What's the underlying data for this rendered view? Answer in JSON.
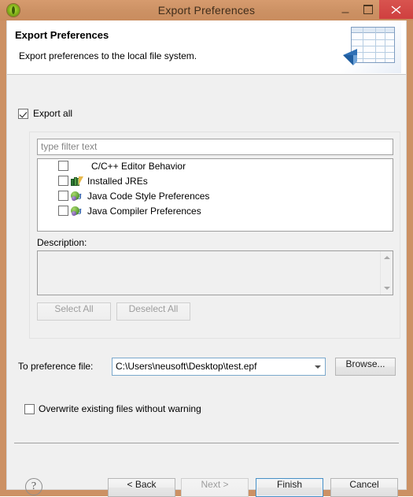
{
  "window": {
    "title": "Export Preferences",
    "icon": "eclipse-round-icon",
    "minimize_label": "Minimize",
    "maximize_label": "Maximize",
    "close_label": "Close"
  },
  "banner": {
    "title": "Export Preferences",
    "subtitle": "Export preferences to the local file system.",
    "art_icon": "export-table-arrow-icon"
  },
  "export_all": {
    "label": "Export all",
    "checked": true
  },
  "filter": {
    "placeholder": "type filter text",
    "value": ""
  },
  "tree": {
    "items": [
      {
        "label": "C/C++ Editor Behavior",
        "checked": false,
        "icon": "none"
      },
      {
        "label": "Installed JREs",
        "checked": false,
        "icon": "jre-books-icon"
      },
      {
        "label": "Java Code Style Preferences",
        "checked": false,
        "icon": "java-preference-icon"
      },
      {
        "label": "Java Compiler Preferences",
        "checked": false,
        "icon": "java-preference-icon"
      }
    ]
  },
  "description": {
    "label": "Description:",
    "value": ""
  },
  "selection_buttons": {
    "select_all": "Select All",
    "deselect_all": "Deselect All"
  },
  "preference_file": {
    "label": "To preference file:",
    "value": "C:\\Users\\neusoft\\Desktop\\test.epf",
    "browse_label": "Browse..."
  },
  "overwrite": {
    "label": "Overwrite existing files without warning",
    "checked": false
  },
  "footer": {
    "help_glyph": "?",
    "back": "< Back",
    "next": "Next >",
    "finish": "Finish",
    "cancel": "Cancel"
  },
  "colors": {
    "titlebar": "#cc9164",
    "close_button": "#cf3f3f",
    "dialog_bg": "#f0f0f0",
    "focus_border": "#4a90c4"
  }
}
